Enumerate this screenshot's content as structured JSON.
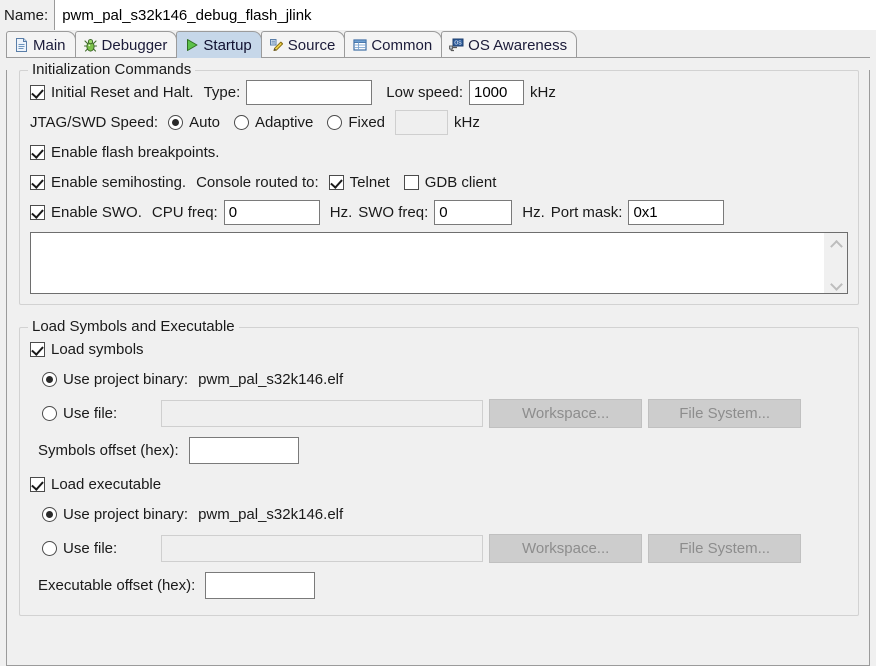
{
  "name_field": {
    "label": "Name:",
    "value": "pwm_pal_s32k146_debug_flash_jlink"
  },
  "tabs": [
    {
      "label": "Main",
      "icon": "document-icon",
      "selected": false
    },
    {
      "label": "Debugger",
      "icon": "bug-icon",
      "selected": false
    },
    {
      "label": "Startup",
      "icon": "play-icon",
      "selected": true
    },
    {
      "label": "Source",
      "icon": "pencil-icon",
      "selected": false
    },
    {
      "label": "Common",
      "icon": "window-icon",
      "selected": false
    },
    {
      "label": "OS Awareness",
      "icon": "monitor-os-icon",
      "selected": false
    }
  ],
  "init_group": {
    "title": "Initialization Commands",
    "initial_reset": {
      "label": "Initial Reset and Halt.",
      "checked": true,
      "type_label": "Type:",
      "type_value": "",
      "low_speed_label": "Low speed:",
      "low_speed_value": "1000",
      "low_speed_unit": "kHz"
    },
    "jtag_speed": {
      "label": "JTAG/SWD Speed:",
      "options": [
        "Auto",
        "Adaptive",
        "Fixed"
      ],
      "selected": "Auto",
      "fixed_value": "",
      "fixed_unit": "kHz"
    },
    "flash_breakpoints": {
      "label": "Enable flash breakpoints.",
      "checked": true
    },
    "semihosting": {
      "label": "Enable semihosting.",
      "checked": true,
      "console_label": "Console routed to:",
      "telnet_label": "Telnet",
      "telnet_checked": true,
      "gdb_label": "GDB client",
      "gdb_checked": false
    },
    "swo": {
      "label": "Enable SWO.",
      "checked": true,
      "cpu_freq_label": "CPU freq:",
      "cpu_freq_value": "0",
      "cpu_freq_unit": "Hz.",
      "swo_freq_label": "SWO freq:",
      "swo_freq_value": "0",
      "swo_freq_unit": "Hz.",
      "port_mask_label": "Port mask:",
      "port_mask_value": "0x1"
    },
    "commands_text": ""
  },
  "load_group": {
    "title": "Load Symbols and Executable",
    "load_symbols": {
      "label": "Load symbols",
      "checked": true,
      "project_binary_label": "Use project binary:",
      "project_binary_value": "pwm_pal_s32k146.elf",
      "project_binary_selected": true,
      "use_file_label": "Use file:",
      "use_file_selected": false,
      "use_file_value": "",
      "workspace_button": "Workspace...",
      "filesystem_button": "File System...",
      "offset_label": "Symbols offset (hex):",
      "offset_value": ""
    },
    "load_executable": {
      "label": "Load executable",
      "checked": true,
      "project_binary_label": "Use project binary:",
      "project_binary_value": "pwm_pal_s32k146.elf",
      "project_binary_selected": true,
      "use_file_label": "Use file:",
      "use_file_selected": false,
      "use_file_value": "",
      "workspace_button": "Workspace...",
      "filesystem_button": "File System...",
      "offset_label": "Executable offset (hex):",
      "offset_value": ""
    }
  },
  "colors": {
    "panel": "#f0f0f0",
    "selected_tab": "#c6d7e9",
    "border": "#9b9b9b",
    "group_border": "#d2d2d2",
    "disabled_text": "#8d8d8d"
  }
}
